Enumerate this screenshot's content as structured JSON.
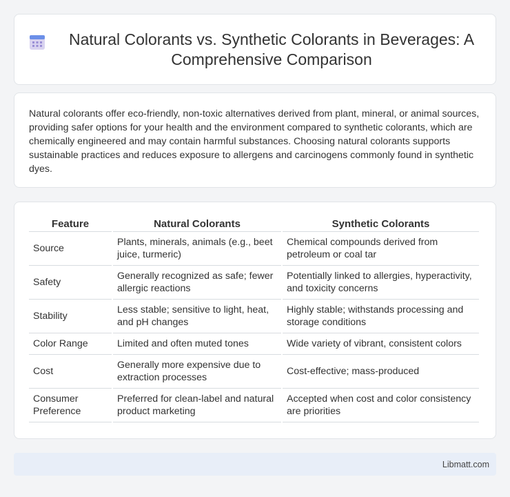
{
  "header": {
    "title": "Natural Colorants vs. Synthetic Colorants in Beverages: A Comprehensive Comparison",
    "icon": "calendar-icon",
    "icon_colors": {
      "top": "#6b8fe8",
      "body": "#d9d3f0",
      "dots": "#9b8fd6"
    }
  },
  "intro": {
    "text": "Natural colorants offer eco-friendly, non-toxic alternatives derived from plant, mineral, or animal sources, providing safer options for your health and the environment compared to synthetic colorants, which are chemically engineered and may contain harmful substances. Choosing natural colorants supports sustainable practices and reduces exposure to allergens and carcinogens commonly found in synthetic dyes."
  },
  "table": {
    "headers": [
      "Feature",
      "Natural Colorants",
      "Synthetic Colorants"
    ],
    "rows": [
      {
        "feature": "Source",
        "natural": "Plants, minerals, animals (e.g., beet juice, turmeric)",
        "synthetic": "Chemical compounds derived from petroleum or coal tar"
      },
      {
        "feature": "Safety",
        "natural": "Generally recognized as safe; fewer allergic reactions",
        "synthetic": "Potentially linked to allergies, hyperactivity, and toxicity concerns"
      },
      {
        "feature": "Stability",
        "natural": "Less stable; sensitive to light, heat, and pH changes",
        "synthetic": "Highly stable; withstands processing and storage conditions"
      },
      {
        "feature": "Color Range",
        "natural": "Limited and often muted tones",
        "synthetic": "Wide variety of vibrant, consistent colors"
      },
      {
        "feature": "Cost",
        "natural": "Generally more expensive due to extraction processes",
        "synthetic": "Cost-effective; mass-produced"
      },
      {
        "feature": "Consumer Preference",
        "natural": "Preferred for clean-label and natural product marketing",
        "synthetic": "Accepted when cost and color consistency are priorities"
      }
    ]
  },
  "footer": {
    "text": "Libmatt.com"
  }
}
